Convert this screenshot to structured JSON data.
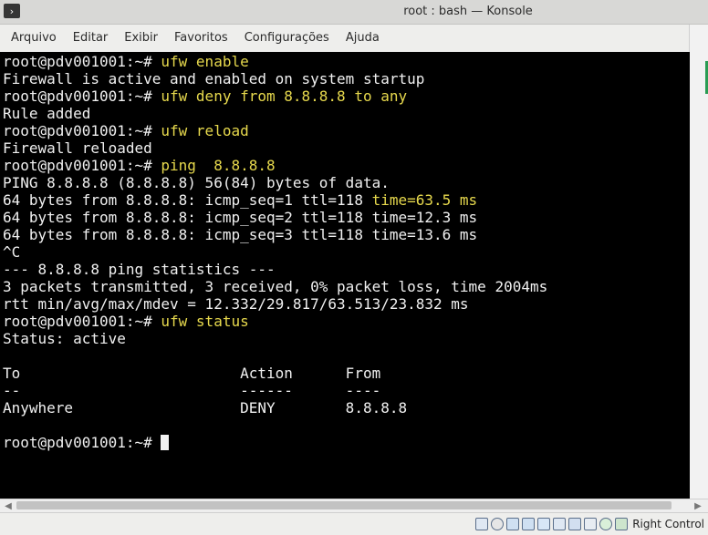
{
  "window": {
    "title": "root : bash — Konsole",
    "left_button_glyph": "›"
  },
  "menubar": {
    "items": [
      "Arquivo",
      "Editar",
      "Exibir",
      "Favoritos",
      "Configurações",
      "Ajuda"
    ]
  },
  "terminal": {
    "lines": [
      {
        "prompt": "root@pdv001001:~# ",
        "command": "ufw enable"
      },
      {
        "text": "Firewall is active and enabled on system startup"
      },
      {
        "prompt": "root@pdv001001:~# ",
        "command": "ufw deny from 8.8.8.8 to any"
      },
      {
        "text": "Rule added"
      },
      {
        "prompt": "root@pdv001001:~# ",
        "command": "ufw reload"
      },
      {
        "text": "Firewall reloaded"
      },
      {
        "prompt": "root@pdv001001:~# ",
        "command": "ping  8.8.8.8"
      },
      {
        "text": "PING 8.8.8.8 (8.8.8.8) 56(84) bytes of data."
      },
      {
        "text": "64 bytes from 8.8.8.8: icmp_seq=1 ttl=118 ",
        "highlight": "time=63.5 ms"
      },
      {
        "text": "64 bytes from 8.8.8.8: icmp_seq=2 ttl=118 time=12.3 ms"
      },
      {
        "text": "64 bytes from 8.8.8.8: icmp_seq=3 ttl=118 time=13.6 ms"
      },
      {
        "text": "^C"
      },
      {
        "text": "--- 8.8.8.8 ping statistics ---"
      },
      {
        "text": "3 packets transmitted, 3 received, 0% packet loss, time 2004ms"
      },
      {
        "text": "rtt min/avg/max/mdev = 12.332/29.817/63.513/23.832 ms"
      },
      {
        "prompt": "root@pdv001001:~# ",
        "command": "ufw status"
      },
      {
        "text": "Status: active"
      },
      {
        "text": ""
      },
      {
        "text": "To                         Action      From"
      },
      {
        "text": "--                         ------      ----"
      },
      {
        "text": "Anywhere                   DENY        8.8.8.8"
      },
      {
        "text": ""
      },
      {
        "prompt": "root@pdv001001:~# ",
        "command": "",
        "cursor": true
      }
    ]
  },
  "statusbar": {
    "host_key_label": "Right Control",
    "tray_icons": [
      "hard-disk-icon",
      "optical-drive-icon",
      "usb-icon",
      "network-icon",
      "pencil-icon",
      "display-icon",
      "screen-capture-icon",
      "recording-icon",
      "mouse-integration-icon",
      "arrow-down-icon"
    ]
  },
  "colors": {
    "terminal_bg": "#000000",
    "terminal_fg": "#f0f0f0",
    "command_color": "#e7d94d",
    "scroll_accent": "#2a9c53"
  }
}
